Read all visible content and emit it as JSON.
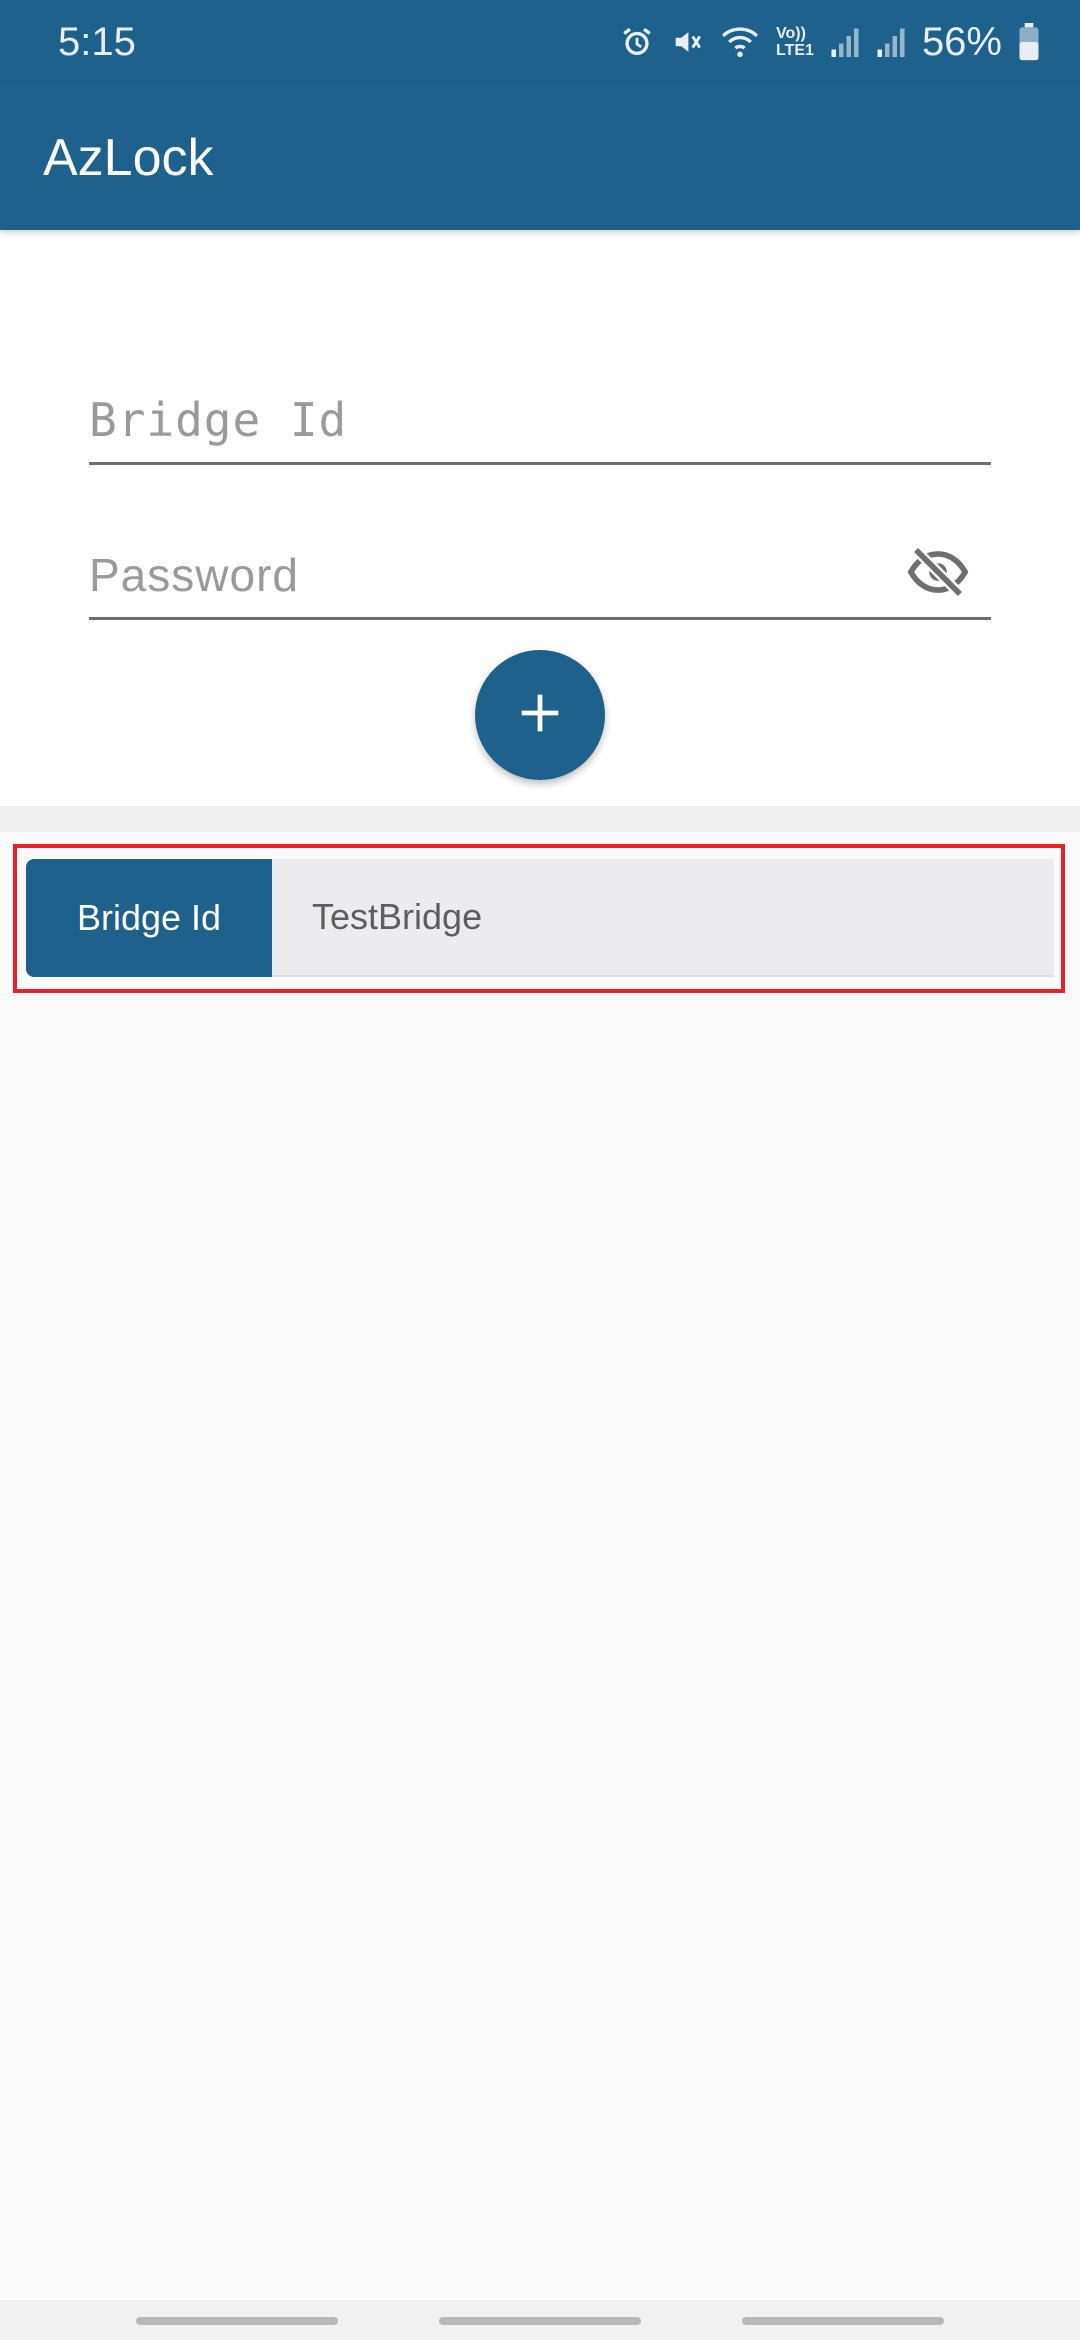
{
  "status_bar": {
    "time": "5:15",
    "battery": "56%",
    "icons": [
      "alarm-icon",
      "mute-icon",
      "wifi-icon",
      "volte-lte-icon",
      "signal-icon",
      "signal-icon",
      "battery-icon"
    ],
    "volte_text": "Vo))",
    "lte_text": "LTE1"
  },
  "app_bar": {
    "title": "AzLock"
  },
  "form": {
    "bridge_id_placeholder": "Bridge Id",
    "password_placeholder": "Password",
    "password_toggle_icon": "visibility-off-icon",
    "add_button_icon": "plus-icon"
  },
  "bridges": [
    {
      "label": "Bridge Id",
      "value": "TestBridge"
    }
  ],
  "colors": {
    "primary": "#1f618d",
    "highlight": "#e8202a",
    "row_value_background": "#ececee"
  }
}
